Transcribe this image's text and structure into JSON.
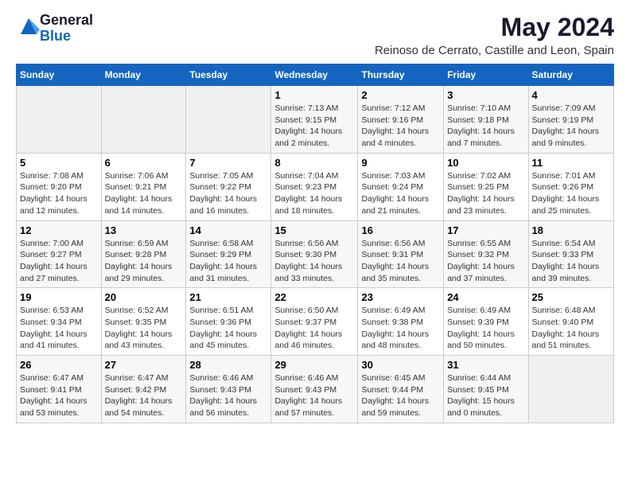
{
  "logo": {
    "general": "General",
    "blue": "Blue"
  },
  "header": {
    "title": "May 2024",
    "subtitle": "Reinoso de Cerrato, Castille and Leon, Spain"
  },
  "columns": [
    "Sunday",
    "Monday",
    "Tuesday",
    "Wednesday",
    "Thursday",
    "Friday",
    "Saturday"
  ],
  "weeks": [
    [
      {
        "day": "",
        "sunrise": "",
        "sunset": "",
        "daylight": "",
        "empty": true
      },
      {
        "day": "",
        "sunrise": "",
        "sunset": "",
        "daylight": "",
        "empty": true
      },
      {
        "day": "",
        "sunrise": "",
        "sunset": "",
        "daylight": "",
        "empty": true
      },
      {
        "day": "1",
        "sunrise": "Sunrise: 7:13 AM",
        "sunset": "Sunset: 9:15 PM",
        "daylight": "Daylight: 14 hours and 2 minutes."
      },
      {
        "day": "2",
        "sunrise": "Sunrise: 7:12 AM",
        "sunset": "Sunset: 9:16 PM",
        "daylight": "Daylight: 14 hours and 4 minutes."
      },
      {
        "day": "3",
        "sunrise": "Sunrise: 7:10 AM",
        "sunset": "Sunset: 9:18 PM",
        "daylight": "Daylight: 14 hours and 7 minutes."
      },
      {
        "day": "4",
        "sunrise": "Sunrise: 7:09 AM",
        "sunset": "Sunset: 9:19 PM",
        "daylight": "Daylight: 14 hours and 9 minutes."
      }
    ],
    [
      {
        "day": "5",
        "sunrise": "Sunrise: 7:08 AM",
        "sunset": "Sunset: 9:20 PM",
        "daylight": "Daylight: 14 hours and 12 minutes."
      },
      {
        "day": "6",
        "sunrise": "Sunrise: 7:06 AM",
        "sunset": "Sunset: 9:21 PM",
        "daylight": "Daylight: 14 hours and 14 minutes."
      },
      {
        "day": "7",
        "sunrise": "Sunrise: 7:05 AM",
        "sunset": "Sunset: 9:22 PM",
        "daylight": "Daylight: 14 hours and 16 minutes."
      },
      {
        "day": "8",
        "sunrise": "Sunrise: 7:04 AM",
        "sunset": "Sunset: 9:23 PM",
        "daylight": "Daylight: 14 hours and 18 minutes."
      },
      {
        "day": "9",
        "sunrise": "Sunrise: 7:03 AM",
        "sunset": "Sunset: 9:24 PM",
        "daylight": "Daylight: 14 hours and 21 minutes."
      },
      {
        "day": "10",
        "sunrise": "Sunrise: 7:02 AM",
        "sunset": "Sunset: 9:25 PM",
        "daylight": "Daylight: 14 hours and 23 minutes."
      },
      {
        "day": "11",
        "sunrise": "Sunrise: 7:01 AM",
        "sunset": "Sunset: 9:26 PM",
        "daylight": "Daylight: 14 hours and 25 minutes."
      }
    ],
    [
      {
        "day": "12",
        "sunrise": "Sunrise: 7:00 AM",
        "sunset": "Sunset: 9:27 PM",
        "daylight": "Daylight: 14 hours and 27 minutes."
      },
      {
        "day": "13",
        "sunrise": "Sunrise: 6:59 AM",
        "sunset": "Sunset: 9:28 PM",
        "daylight": "Daylight: 14 hours and 29 minutes."
      },
      {
        "day": "14",
        "sunrise": "Sunrise: 6:58 AM",
        "sunset": "Sunset: 9:29 PM",
        "daylight": "Daylight: 14 hours and 31 minutes."
      },
      {
        "day": "15",
        "sunrise": "Sunrise: 6:56 AM",
        "sunset": "Sunset: 9:30 PM",
        "daylight": "Daylight: 14 hours and 33 minutes."
      },
      {
        "day": "16",
        "sunrise": "Sunrise: 6:56 AM",
        "sunset": "Sunset: 9:31 PM",
        "daylight": "Daylight: 14 hours and 35 minutes."
      },
      {
        "day": "17",
        "sunrise": "Sunrise: 6:55 AM",
        "sunset": "Sunset: 9:32 PM",
        "daylight": "Daylight: 14 hours and 37 minutes."
      },
      {
        "day": "18",
        "sunrise": "Sunrise: 6:54 AM",
        "sunset": "Sunset: 9:33 PM",
        "daylight": "Daylight: 14 hours and 39 minutes."
      }
    ],
    [
      {
        "day": "19",
        "sunrise": "Sunrise: 6:53 AM",
        "sunset": "Sunset: 9:34 PM",
        "daylight": "Daylight: 14 hours and 41 minutes."
      },
      {
        "day": "20",
        "sunrise": "Sunrise: 6:52 AM",
        "sunset": "Sunset: 9:35 PM",
        "daylight": "Daylight: 14 hours and 43 minutes."
      },
      {
        "day": "21",
        "sunrise": "Sunrise: 6:51 AM",
        "sunset": "Sunset: 9:36 PM",
        "daylight": "Daylight: 14 hours and 45 minutes."
      },
      {
        "day": "22",
        "sunrise": "Sunrise: 6:50 AM",
        "sunset": "Sunset: 9:37 PM",
        "daylight": "Daylight: 14 hours and 46 minutes."
      },
      {
        "day": "23",
        "sunrise": "Sunrise: 6:49 AM",
        "sunset": "Sunset: 9:38 PM",
        "daylight": "Daylight: 14 hours and 48 minutes."
      },
      {
        "day": "24",
        "sunrise": "Sunrise: 6:49 AM",
        "sunset": "Sunset: 9:39 PM",
        "daylight": "Daylight: 14 hours and 50 minutes."
      },
      {
        "day": "25",
        "sunrise": "Sunrise: 6:48 AM",
        "sunset": "Sunset: 9:40 PM",
        "daylight": "Daylight: 14 hours and 51 minutes."
      }
    ],
    [
      {
        "day": "26",
        "sunrise": "Sunrise: 6:47 AM",
        "sunset": "Sunset: 9:41 PM",
        "daylight": "Daylight: 14 hours and 53 minutes."
      },
      {
        "day": "27",
        "sunrise": "Sunrise: 6:47 AM",
        "sunset": "Sunset: 9:42 PM",
        "daylight": "Daylight: 14 hours and 54 minutes."
      },
      {
        "day": "28",
        "sunrise": "Sunrise: 6:46 AM",
        "sunset": "Sunset: 9:43 PM",
        "daylight": "Daylight: 14 hours and 56 minutes."
      },
      {
        "day": "29",
        "sunrise": "Sunrise: 6:46 AM",
        "sunset": "Sunset: 9:43 PM",
        "daylight": "Daylight: 14 hours and 57 minutes."
      },
      {
        "day": "30",
        "sunrise": "Sunrise: 6:45 AM",
        "sunset": "Sunset: 9:44 PM",
        "daylight": "Daylight: 14 hours and 59 minutes."
      },
      {
        "day": "31",
        "sunrise": "Sunrise: 6:44 AM",
        "sunset": "Sunset: 9:45 PM",
        "daylight": "Daylight: 15 hours and 0 minutes."
      },
      {
        "day": "",
        "sunrise": "",
        "sunset": "",
        "daylight": "",
        "empty": true
      }
    ]
  ]
}
